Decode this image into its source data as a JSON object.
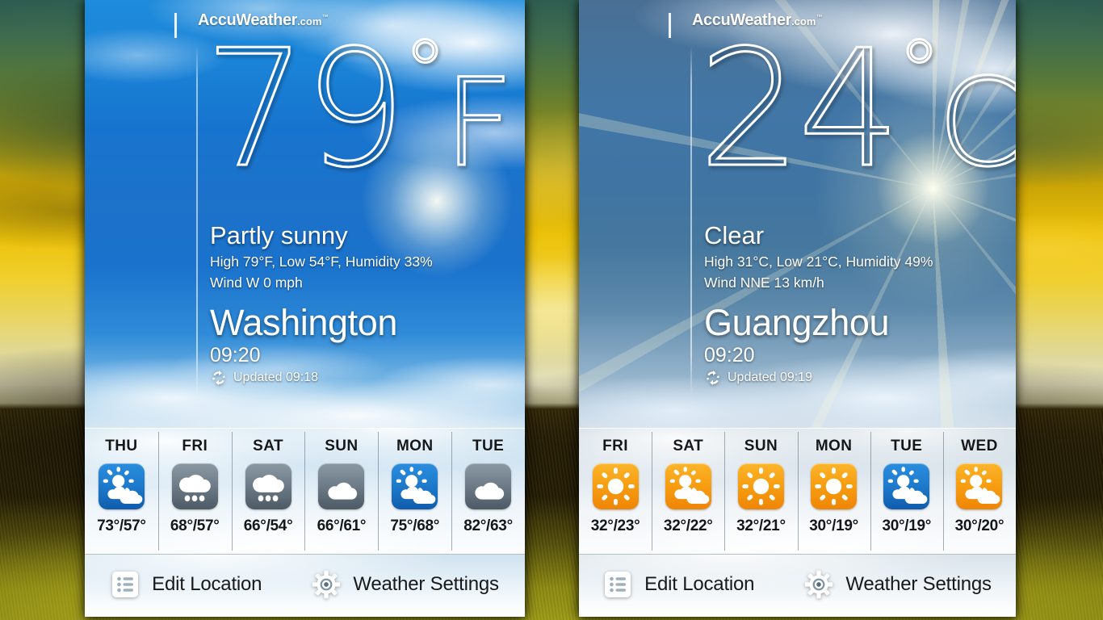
{
  "wallpaper": {
    "description": "sunset-landscape-wallpaper"
  },
  "widgets": [
    {
      "id": "washington",
      "brand": {
        "name": "AccuWeather",
        "domain": ".com",
        "trademark": "™"
      },
      "temperature": "79",
      "degree_symbol": "°",
      "unit": "F",
      "condition": "Partly sunny",
      "detail_line1": "High 79°F, Low 54°F, Humidity 33%",
      "detail_line2": "Wind W 0 mph",
      "city": "Washington",
      "time": "09:20",
      "updated": "Updated 09:18",
      "refresh_icon": "refresh-icon",
      "forecast": [
        {
          "day": "THU",
          "icon": "partly-sunny-icon",
          "icon_style": "blue",
          "temps": "73°/57°"
        },
        {
          "day": "FRI",
          "icon": "rain-icon",
          "icon_style": "gray",
          "temps": "68°/57°"
        },
        {
          "day": "SAT",
          "icon": "rain-icon",
          "icon_style": "gray",
          "temps": "66°/54°"
        },
        {
          "day": "SUN",
          "icon": "cloudy-icon",
          "icon_style": "gray",
          "temps": "66°/61°"
        },
        {
          "day": "MON",
          "icon": "partly-sunny-icon",
          "icon_style": "blue",
          "temps": "75°/68°"
        },
        {
          "day": "TUE",
          "icon": "cloudy-icon",
          "icon_style": "gray",
          "temps": "82°/63°"
        }
      ],
      "toolbar": {
        "edit_location": "Edit Location",
        "edit_location_icon": "list-icon",
        "weather_settings": "Weather Settings",
        "weather_settings_icon": "gear-icon"
      }
    },
    {
      "id": "guangzhou",
      "brand": {
        "name": "AccuWeather",
        "domain": ".com",
        "trademark": "™"
      },
      "temperature": "24",
      "degree_symbol": "°",
      "unit": "C",
      "condition": "Clear",
      "detail_line1": "High 31°C, Low 21°C, Humidity 49%",
      "detail_line2": "Wind NNE 13 km/h",
      "city": "Guangzhou",
      "time": "09:20",
      "updated": "Updated 09:19",
      "refresh_icon": "refresh-icon",
      "forecast": [
        {
          "day": "FRI",
          "icon": "sunny-icon",
          "icon_style": "orange",
          "temps": "32°/23°"
        },
        {
          "day": "SAT",
          "icon": "partly-sunny-icon",
          "icon_style": "orange",
          "temps": "32°/22°"
        },
        {
          "day": "SUN",
          "icon": "sunny-icon",
          "icon_style": "orange",
          "temps": "32°/21°"
        },
        {
          "day": "MON",
          "icon": "sunny-icon",
          "icon_style": "orange",
          "temps": "30°/19°"
        },
        {
          "day": "TUE",
          "icon": "partly-sunny-icon",
          "icon_style": "blue",
          "temps": "30°/19°"
        },
        {
          "day": "WED",
          "icon": "partly-sunny-icon",
          "icon_style": "orange",
          "temps": "30°/20°"
        }
      ],
      "toolbar": {
        "edit_location": "Edit Location",
        "edit_location_icon": "list-icon",
        "weather_settings": "Weather Settings",
        "weather_settings_icon": "gear-icon"
      }
    }
  ],
  "colors": {
    "icon_blue": "#1f7ccd",
    "icon_gray": "#6f7e8a",
    "icon_orange": "#f79f12",
    "hero_blue": "#1774ce",
    "hero_steel": "#4176a6",
    "text_dark": "#15181a"
  }
}
